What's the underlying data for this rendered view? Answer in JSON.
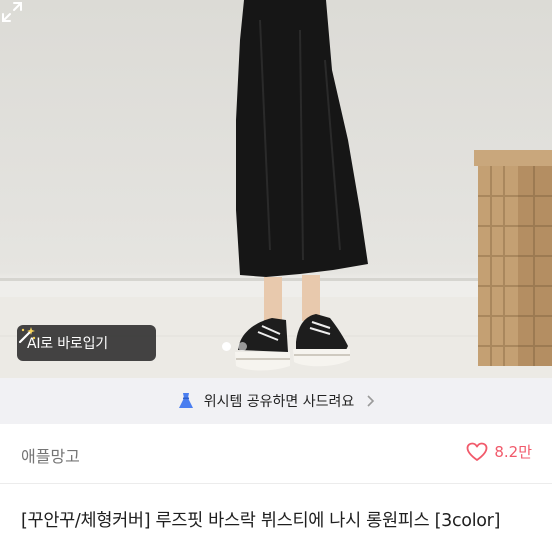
{
  "product": {
    "ai_button_label": "AI로 바로입기",
    "carousel": {
      "count": 2,
      "active": 1
    }
  },
  "wishlist_banner": {
    "text": "위시템 공유하면 사드려요"
  },
  "seller": {
    "name": "애플망고"
  },
  "likes": {
    "count": "8.2만"
  },
  "title": {
    "text": "[꾸안꾸/체형커버] 루즈핏 바스락 뷔스티에 나시 롱원피스 [3color]"
  },
  "colors": {
    "accent": "#f15a6b",
    "banner_bg": "#f1f1f4",
    "banner_icon": "#4a7ef0"
  },
  "icons": [
    "magic-wand-icon",
    "expand-icon",
    "dress-icon",
    "chevron-right-icon",
    "heart-icon"
  ]
}
